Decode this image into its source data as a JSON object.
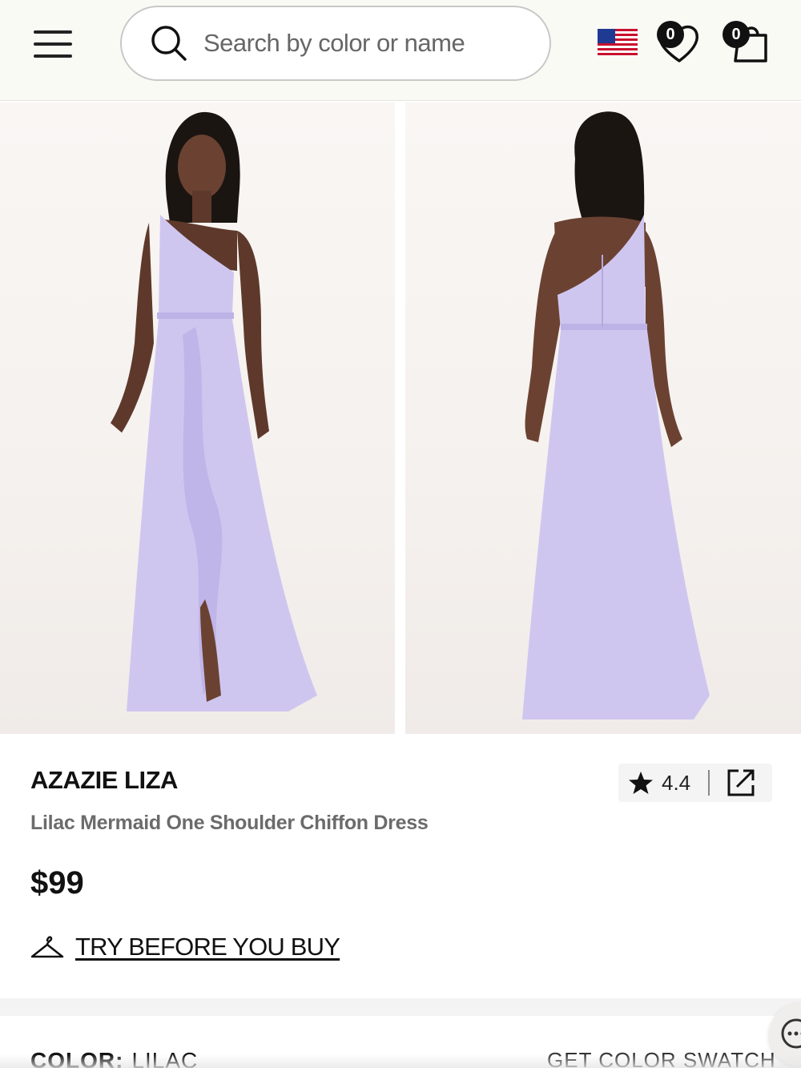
{
  "header": {
    "search_placeholder": "Search by color or name",
    "wishlist_count": "0",
    "cart_count": "0"
  },
  "product": {
    "brand": "AZAZIE LIZA",
    "subtitle": "Lilac Mermaid One Shoulder Chiffon Dress",
    "price": "$99",
    "rating": "4.4",
    "try_before_label": "TRY BEFORE YOU BUY",
    "dress_color": "#cfc6f0"
  },
  "color_section": {
    "label": "COLOR:",
    "color_name": "LILAC",
    "swatch_link": "GET COLOR SWATCH"
  },
  "icons": [
    "menu-icon",
    "search-icon",
    "us-flag-icon",
    "heart-icon",
    "shopping-bag-icon",
    "star-icon",
    "share-icon",
    "hanger-icon",
    "chat-icon"
  ]
}
